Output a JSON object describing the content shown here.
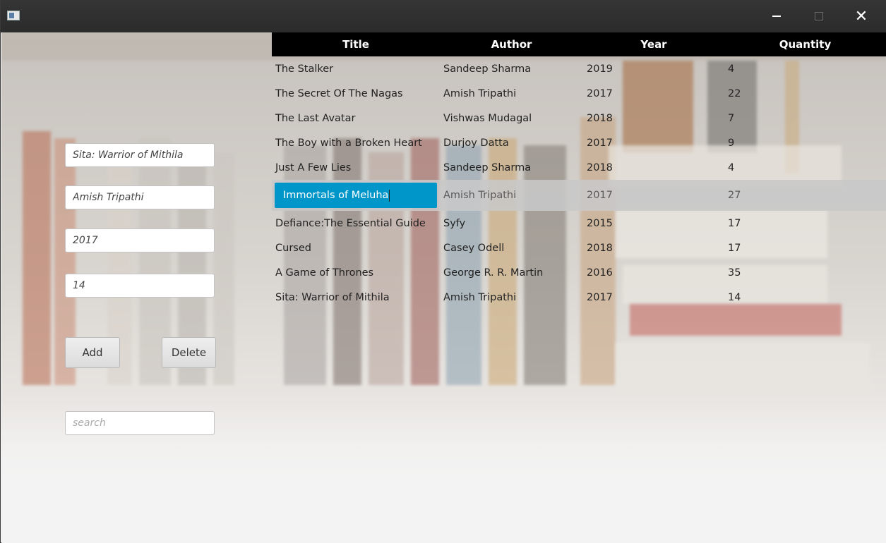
{
  "window": {
    "minimize_label": "—",
    "maximize_label": "□",
    "close_label": "✕",
    "app_icon": "app-icon"
  },
  "form": {
    "title_value": "Sita: Warrior of Mithila",
    "author_value": "Amish Tripathi",
    "year_value": "2017",
    "quantity_value": "14",
    "add_label": "Add",
    "delete_label": "Delete",
    "search_placeholder": "search"
  },
  "table": {
    "columns": [
      "Title",
      "Author",
      "Year",
      "Quantity"
    ],
    "rows": [
      {
        "title": "The Stalker",
        "author": "Sandeep Sharma",
        "year": "2019",
        "quantity": "4"
      },
      {
        "title": "The Secret Of The Nagas",
        "author": "Amish Tripathi",
        "year": "2017",
        "quantity": "22"
      },
      {
        "title": "The Last Avatar",
        "author": "Vishwas Mudagal",
        "year": "2018",
        "quantity": "7"
      },
      {
        "title": "The Boy with a Broken Heart",
        "author": "Durjoy Datta",
        "year": "2017",
        "quantity": "9"
      },
      {
        "title": "Just A Few Lies",
        "author": "Sandeep Sharma",
        "year": "2018",
        "quantity": "4"
      },
      {
        "title": "Immortals of Meluha",
        "author": "Amish Tripathi",
        "year": "2017",
        "quantity": "27"
      },
      {
        "title": "Defiance:The Essential Guide",
        "author": "Syfy",
        "year": "2015",
        "quantity": "17"
      },
      {
        "title": "Cursed",
        "author": "Casey Odell",
        "year": "2018",
        "quantity": "17"
      },
      {
        "title": "A Game of Thrones",
        "author": "George R. R. Martin",
        "year": "2016",
        "quantity": "35"
      },
      {
        "title": "Sita: Warrior of Mithila",
        "author": "Amish Tripathi",
        "year": "2017",
        "quantity": "14"
      }
    ],
    "selected_row_index": 5,
    "edit_color": "#0096c9"
  }
}
